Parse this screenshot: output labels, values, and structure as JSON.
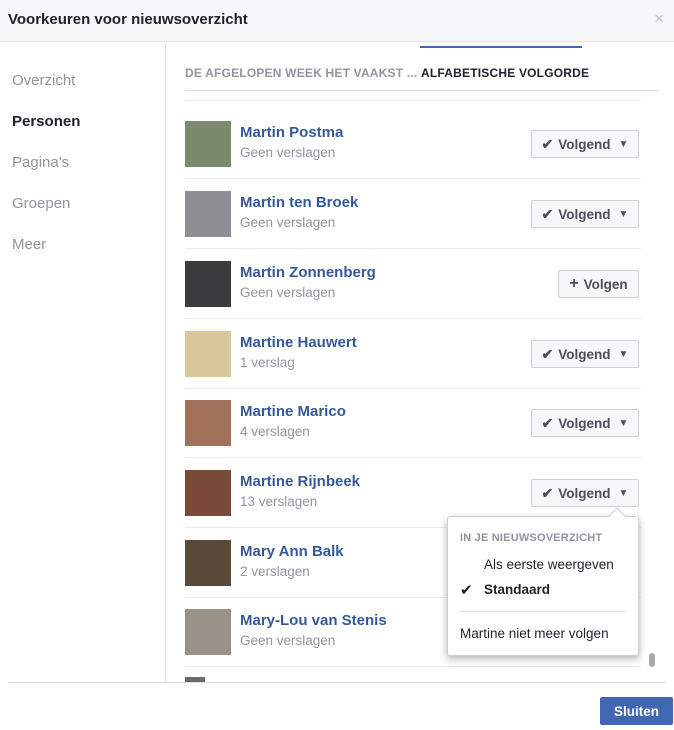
{
  "dialog": {
    "title": "Voorkeuren voor nieuwsoverzicht",
    "close_icon": "×"
  },
  "sidebar": {
    "items": [
      {
        "label": "Overzicht",
        "active": false
      },
      {
        "label": "Personen",
        "active": true
      },
      {
        "label": "Pagina's",
        "active": false
      },
      {
        "label": "Groepen",
        "active": false
      },
      {
        "label": "Meer",
        "active": false
      }
    ]
  },
  "tabs": [
    {
      "label": "DE AFGELOPEN WEEK HET VAAKST ...",
      "active": false
    },
    {
      "label": "ALFABETISCHE VOLGORDE",
      "active": true
    }
  ],
  "people": [
    {
      "name": "Martin Postma",
      "subtitle": "Geen verslagen",
      "status": "following",
      "avatar_color": "#7b8a6a"
    },
    {
      "name": "Martin ten Broek",
      "subtitle": "Geen verslagen",
      "status": "following",
      "avatar_color": "#8d8f93"
    },
    {
      "name": "Martin Zonnenberg",
      "subtitle": "Geen verslagen",
      "status": "not_following",
      "avatar_color": "#3a3b3d"
    },
    {
      "name": "Martine Hauwert",
      "subtitle": "1 verslag",
      "status": "following",
      "avatar_color": "#d8c79a"
    },
    {
      "name": "Martine Marico",
      "subtitle": "4 verslagen",
      "status": "following",
      "avatar_color": "#a0725a"
    },
    {
      "name": "Martine Rijnbeek",
      "subtitle": "13 verslagen",
      "status": "following",
      "avatar_color": "#7a4a38"
    },
    {
      "name": "Mary Ann Balk",
      "subtitle": "2 verslagen",
      "status": "following",
      "avatar_color": "#5a4a3a"
    },
    {
      "name": "Mary-Lou van Stenis",
      "subtitle": "Geen verslagen",
      "status": "following",
      "avatar_color": "#9a9288"
    }
  ],
  "buttons": {
    "following_label": "Volgend",
    "follow_label": "Volgen"
  },
  "dropdown": {
    "heading": "IN JE NIEUWSOVERZICHT",
    "option_first": "Als eerste weergeven",
    "option_default": "Standaard",
    "unfollow": "Martine niet meer volgen"
  },
  "footer": {
    "close_label": "Sluiten"
  },
  "colors": {
    "link": "#365899",
    "accent": "#4267b2"
  }
}
